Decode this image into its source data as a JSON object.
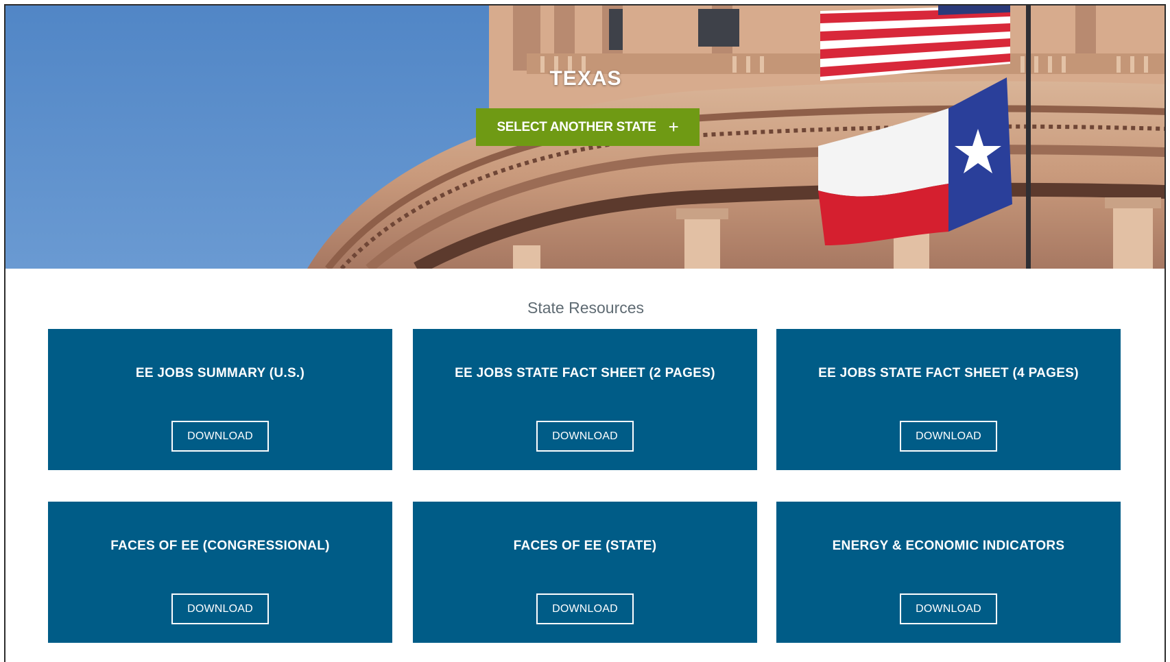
{
  "hero": {
    "state_name": "TEXAS",
    "select_button": {
      "label": "SELECT ANOTHER STATE",
      "icon": "plus-icon",
      "color": "#6f9a14"
    }
  },
  "resources": {
    "heading": "State Resources",
    "card_color": "#005c87",
    "cards": [
      {
        "title": "EE JOBS SUMMARY (U.S.)",
        "button": "DOWNLOAD"
      },
      {
        "title": "EE JOBS STATE FACT SHEET (2 PAGES)",
        "button": "DOWNLOAD"
      },
      {
        "title": "EE JOBS STATE FACT SHEET (4 PAGES)",
        "button": "DOWNLOAD"
      },
      {
        "title": "FACES OF EE (CONGRESSIONAL)",
        "button": "DOWNLOAD"
      },
      {
        "title": "FACES OF EE (STATE)",
        "button": "DOWNLOAD"
      },
      {
        "title": "ENERGY & ECONOMIC INDICATORS",
        "button": "DOWNLOAD"
      }
    ]
  }
}
